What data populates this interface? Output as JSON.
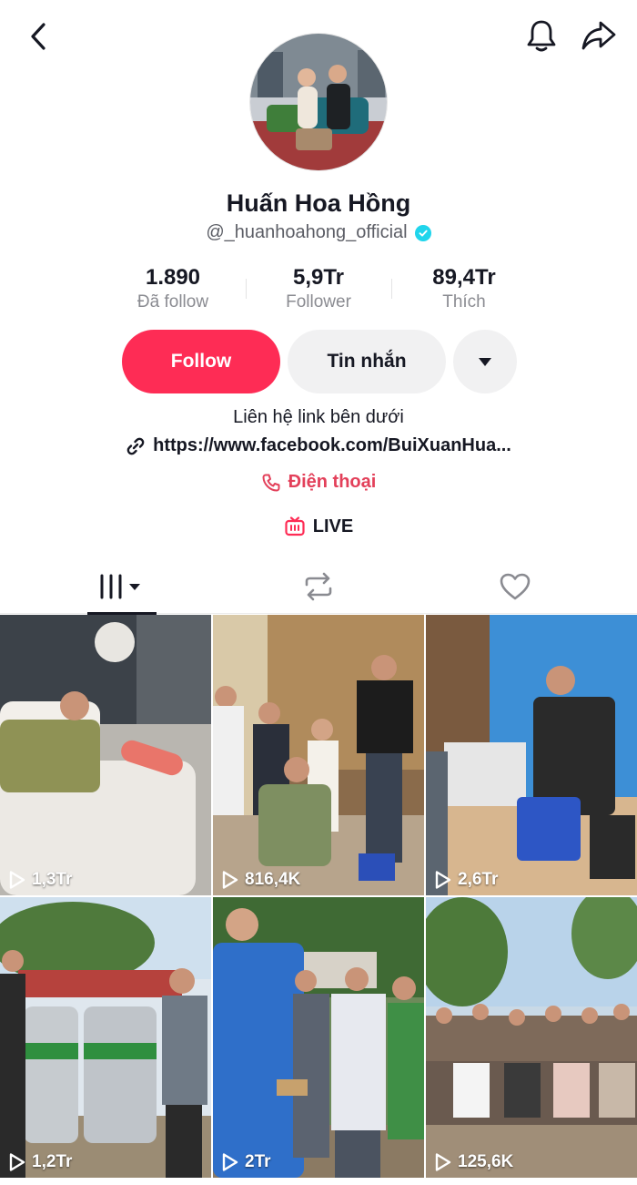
{
  "profile": {
    "name": "Huấn Hoa Hồng",
    "handle": "@_huanhoahong_official",
    "verified": true
  },
  "stats": [
    {
      "value": "1.890",
      "label": "Đã follow"
    },
    {
      "value": "5,9Tr",
      "label": "Follower"
    },
    {
      "value": "89,4Tr",
      "label": "Thích"
    }
  ],
  "actions": {
    "follow_label": "Follow",
    "message_label": "Tin nhắn",
    "more_icon": "caret-down-icon"
  },
  "bio": {
    "text": "Liên hệ link bên dưới",
    "link": "https://www.facebook.com/BuiXuanHua..."
  },
  "phone_label": "Điện thoại",
  "live_label": "LIVE",
  "tabs": [
    {
      "icon": "videos-grid-icon",
      "active": true
    },
    {
      "icon": "repost-icon",
      "active": false
    },
    {
      "icon": "liked-heart-icon",
      "active": false
    }
  ],
  "videos": [
    {
      "views": "1,3Tr"
    },
    {
      "views": "816,4K"
    },
    {
      "views": "2,6Tr"
    },
    {
      "views": "1,2Tr"
    },
    {
      "views": "2Tr"
    },
    {
      "views": "125,6K"
    }
  ],
  "colors": {
    "accent": "#fe2c55",
    "phone": "#e3405a",
    "verified": "#20d5ec",
    "secondary_button": "#f1f1f2"
  }
}
